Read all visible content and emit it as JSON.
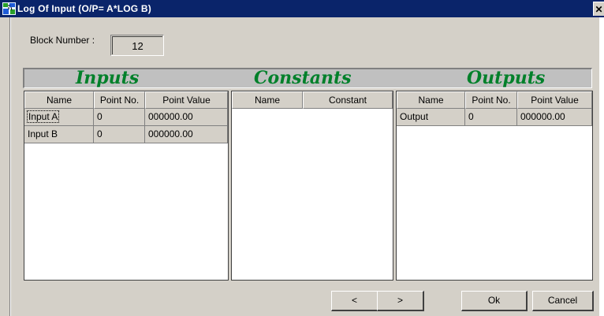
{
  "window": {
    "title": "Log Of Input (O/P= A*LOG B)",
    "close_glyph": "✕",
    "icon": "app-icon"
  },
  "block": {
    "label": "Block Number :",
    "value": "12"
  },
  "sections": {
    "inputs_title": "Inputs",
    "constants_title": "Constants",
    "outputs_title": "Outputs",
    "title_color": "#00802a"
  },
  "inputs": {
    "columns": [
      "Name",
      "Point No.",
      "Point Value"
    ],
    "rows": [
      {
        "name": "Input A",
        "point_no": "0",
        "point_value": "000000.00"
      },
      {
        "name": "Input B",
        "point_no": "0",
        "point_value": "000000.00"
      }
    ]
  },
  "constants": {
    "columns": [
      "Name",
      "Constant"
    ],
    "rows": []
  },
  "outputs": {
    "columns": [
      "Name",
      "Point No.",
      "Point Value"
    ],
    "rows": [
      {
        "name": "Output",
        "point_no": "0",
        "point_value": "000000.00"
      }
    ]
  },
  "buttons": {
    "prev": "<",
    "next": ">",
    "ok": "Ok",
    "cancel": "Cancel"
  }
}
